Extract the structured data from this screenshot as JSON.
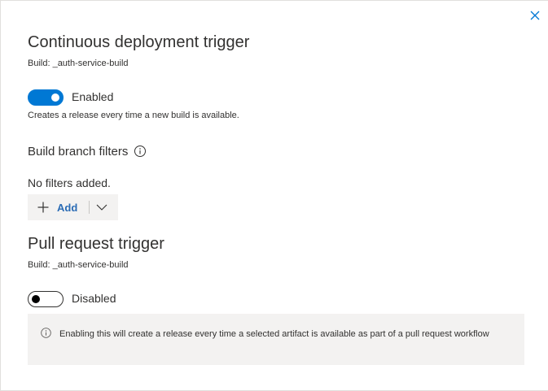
{
  "close": {
    "icon": "close-icon"
  },
  "continuous": {
    "title": "Continuous deployment trigger",
    "build": "Build: _auth-service-build",
    "toggle_state": "on",
    "toggle_label": "Enabled",
    "description": "Creates a release every time a new build is available."
  },
  "filters": {
    "title": "Build branch filters",
    "info_icon": "info-icon",
    "empty_text": "No filters added.",
    "add_label": "Add",
    "add_icon": "plus-icon",
    "dropdown_icon": "chevron-down-icon"
  },
  "pull_request": {
    "title": "Pull request trigger",
    "build": "Build: _auth-service-build",
    "toggle_state": "off",
    "toggle_label": "Disabled",
    "notice_icon": "info-icon",
    "notice_text": "Enabling this will create a release every time a selected artifact is available as part of a pull request workflow"
  },
  "colors": {
    "accent": "#0078d4",
    "link": "#2b6cb5",
    "text": "#323130",
    "muted_bg": "#f3f2f1"
  }
}
